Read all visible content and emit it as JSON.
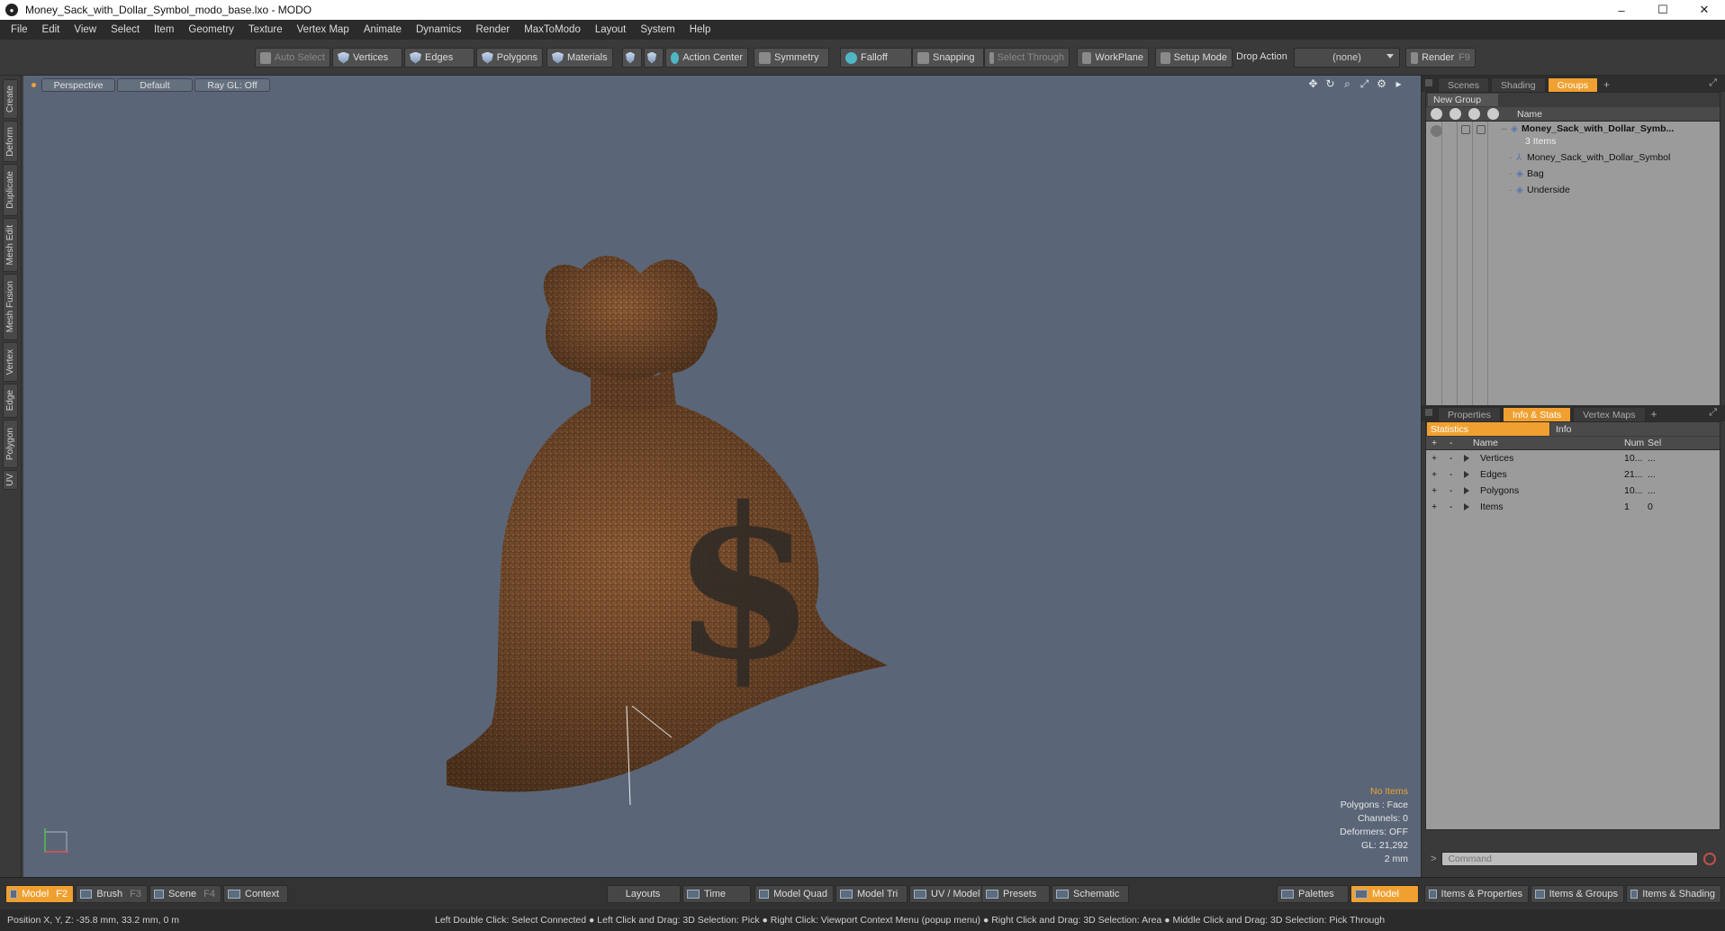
{
  "window": {
    "title": "Money_Sack_with_Dollar_Symbol_modo_base.lxo - MODO",
    "min": "–",
    "max": "☐",
    "close": "✕"
  },
  "menu": [
    "File",
    "Edit",
    "View",
    "Select",
    "Item",
    "Geometry",
    "Texture",
    "Vertex Map",
    "Animate",
    "Dynamics",
    "Render",
    "MaxToModo",
    "Layout",
    "System",
    "Help"
  ],
  "toolbar": {
    "auto_select": "Auto Select",
    "vertices": "Vertices",
    "edges": "Edges",
    "polygons": "Polygons",
    "materials": "Materials",
    "action_center": "Action Center",
    "symmetry": "Symmetry",
    "falloff": "Falloff",
    "snapping": "Snapping",
    "select_through": "Select Through",
    "workplane": "WorkPlane",
    "setup_mode": "Setup Mode",
    "drop_action_label": "Drop Action",
    "drop_action_value": "(none)",
    "render": "Render",
    "render_key": "F9"
  },
  "left_tabs": [
    "Create",
    "Deform",
    "Duplicate",
    "Mesh Edit",
    "Mesh Fusion",
    "Vertex",
    "Edge",
    "Polygon",
    "UV"
  ],
  "viewport": {
    "view": "Perspective",
    "shading": "Default",
    "raygl": "Ray GL: Off",
    "stats": {
      "selection": "No Items",
      "polygons": "Polygons : Face",
      "channels": "Channels: 0",
      "deformers": "Deformers: OFF",
      "gl": "GL: 21,292",
      "scale": "2 mm"
    }
  },
  "scene_tabs": {
    "scenes": "Scenes",
    "shading": "Shading",
    "groups": "Groups",
    "plus": "+"
  },
  "groups": {
    "new_group": "New Group",
    "col_name": "Name",
    "root": "Money_Sack_with_Dollar_Symb...",
    "root_count": "3 Items",
    "children": [
      "Money_Sack_with_Dollar_Symbol",
      "Bag",
      "Underside"
    ]
  },
  "props_tabs": {
    "properties": "Properties",
    "info_stats": "Info & Stats",
    "vertex_maps": "Vertex Maps",
    "plus": "+"
  },
  "stats": {
    "tab_statistics": "Statistics",
    "tab_info": "Info",
    "col_name": "Name",
    "col_num": "Num",
    "col_sel": "Sel",
    "plus": "+",
    "minus": "-",
    "rows": [
      {
        "name": "Vertices",
        "num": "10...",
        "sel": "..."
      },
      {
        "name": "Edges",
        "num": "21...",
        "sel": "..."
      },
      {
        "name": "Polygons",
        "num": "10...",
        "sel": "..."
      },
      {
        "name": "Items",
        "num": "1",
        "sel": "0"
      }
    ]
  },
  "command": {
    "prompt": ">",
    "placeholder": "Command"
  },
  "bottom": {
    "model": "Model",
    "model_key": "F2",
    "brush": "Brush",
    "brush_key": "F3",
    "scene": "Scene",
    "scene_key": "F4",
    "context": "Context",
    "layouts": "Layouts",
    "time": "Time",
    "model_quad": "Model Quad",
    "model_tri": "Model Tri",
    "uv_model": "UV / Model",
    "presets": "Presets",
    "schematic": "Schematic",
    "palettes": "Palettes",
    "model2": "Model",
    "items_props": "Items & Properties",
    "items_groups": "Items & Groups",
    "items_shading": "Items & Shading"
  },
  "status": {
    "position": "Position X, Y, Z:   -35.8 mm, 33.2 mm, 0 m",
    "hints": "Left Double Click: Select Connected ● Left Click and Drag: 3D Selection: Pick ● Right Click: Viewport Context Menu (popup menu) ● Right Click and Drag: 3D Selection: Area ● Middle Click and Drag: 3D Selection: Pick Through"
  },
  "colors": {
    "accent": "#f0a030",
    "viewport_bg": "#5a6678",
    "panel_bg": "#9b9b9b"
  }
}
